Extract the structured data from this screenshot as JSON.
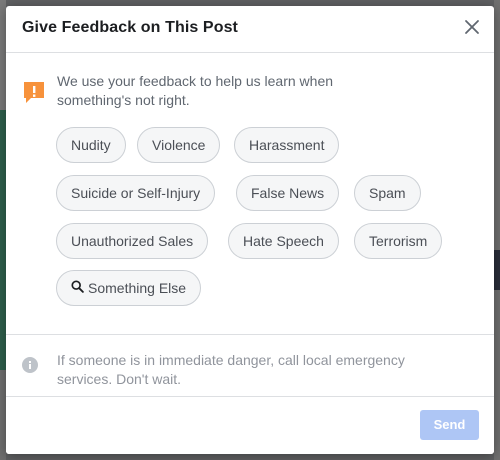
{
  "background": {
    "dim_color": "#5f6062"
  },
  "dialog": {
    "title": "Give Feedback on This Post",
    "close_icon": "close-icon",
    "intro": {
      "icon": "alert-flag-icon",
      "icon_color": "#f7923b",
      "text": "We use your feedback to help us learn when something's not right."
    },
    "options": [
      {
        "label": "Nudity"
      },
      {
        "label": "Violence"
      },
      {
        "label": "Harassment"
      },
      {
        "label": "Suicide or Self-Injury"
      },
      {
        "label": "False News"
      },
      {
        "label": "Spam"
      },
      {
        "label": "Unauthorized Sales"
      },
      {
        "label": "Hate Speech"
      },
      {
        "label": "Terrorism"
      },
      {
        "label": "Something Else",
        "icon": "search-icon"
      }
    ],
    "info": {
      "icon": "info-icon",
      "text": "If someone is in immediate danger, call local emergency services. Don't wait."
    },
    "footer": {
      "send_label": "Send",
      "send_color": "#aec6f5",
      "send_enabled": false
    }
  }
}
